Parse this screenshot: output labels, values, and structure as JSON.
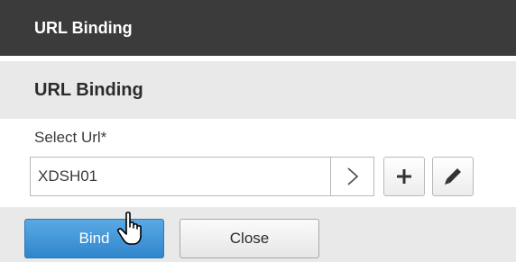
{
  "window": {
    "title": "URL Binding"
  },
  "section": {
    "title": "URL Binding"
  },
  "form": {
    "select_label": "Select Url*",
    "select_value": "XDSH01"
  },
  "icons": {
    "dropdown": "chevron-right-icon",
    "add": "plus-icon",
    "edit": "pencil-icon",
    "cursor": "hand-pointer-icon"
  },
  "footer": {
    "bind_label": "Bind",
    "close_label": "Close"
  },
  "colors": {
    "titlebar_bg": "#3b3b3b",
    "section_bg": "#e9e9e9",
    "primary_button": "#3a8fd3"
  }
}
